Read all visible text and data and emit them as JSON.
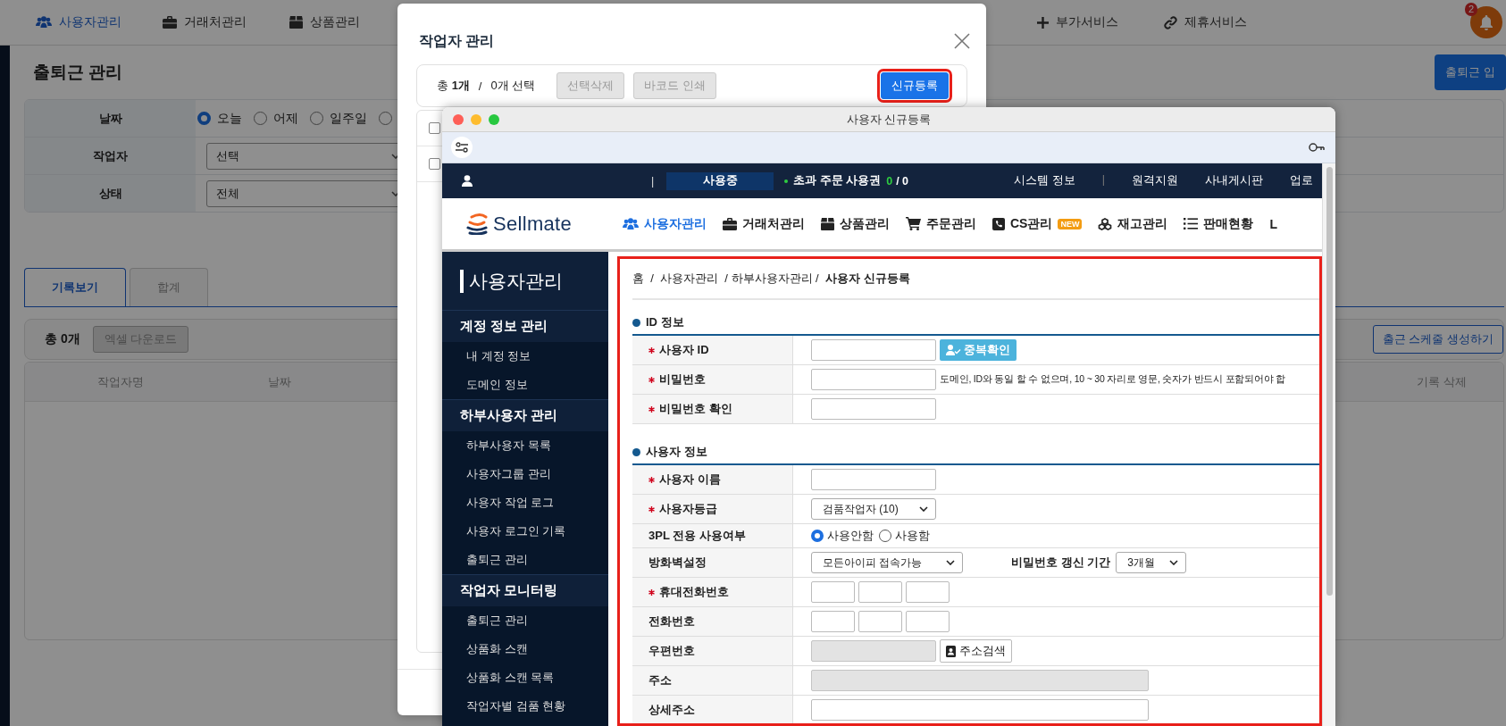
{
  "app_nav": {
    "items": [
      {
        "label": "사용자관리",
        "selected": true
      },
      {
        "label": "거래처관리",
        "selected": false
      },
      {
        "label": "상품관리",
        "selected": false
      }
    ],
    "right_items": [
      {
        "label": "부가서비스"
      },
      {
        "label": "제휴서비스"
      }
    ],
    "notification_badge": "2"
  },
  "page": {
    "title": "출퇴근 관리",
    "top_button": "출퇴근 입",
    "filters": [
      {
        "label": "날짜",
        "kind": "radio",
        "options": [
          {
            "label": "오늘",
            "selected": true
          },
          {
            "label": "어제",
            "selected": false
          },
          {
            "label": "일주일",
            "selected": false
          },
          {
            "selected": false
          }
        ]
      },
      {
        "label": "작업자",
        "kind": "select",
        "value": "선택"
      },
      {
        "label": "상태",
        "kind": "select",
        "value": "전체"
      }
    ],
    "tabs": [
      {
        "label": "기록보기",
        "selected": true
      },
      {
        "label": "합계",
        "selected": false
      }
    ],
    "summary": "총 0개",
    "excel_button": {
      "label": "엑셀 다운로드",
      "disabled": true
    },
    "schedule_button": "출근 스케줄 생성하기",
    "columns": [
      "작업자명",
      "날짜",
      "기록 삭제"
    ]
  },
  "modal": {
    "title": "작업자 관리",
    "summary": "총 **1개**",
    "separator": "/",
    "selection": "0개 선택",
    "buttons": [
      {
        "label": "선택삭제",
        "kind": "plain",
        "disabled": true,
        "highlighted": false
      },
      {
        "label": "바코드 인쇄",
        "kind": "plain",
        "disabled": true,
        "highlighted": false
      },
      {
        "label": "신규등록",
        "kind": "primary",
        "disabled": false,
        "highlighted": true
      }
    ],
    "rows": [
      {
        "checked": false
      },
      {
        "checked": false
      }
    ]
  },
  "signup_window": {
    "title": "사용자 신규등록",
    "topbar": {
      "divider": "|",
      "status": "사용중",
      "quota_label": "초과 주문 사용권",
      "quota_used": "0",
      "quota_total": "/ 0",
      "links": [
        {
          "label": "시스템 정보",
          "divider": "|"
        },
        {
          "label": "원격지원"
        },
        {
          "label": "사내게시판"
        },
        {
          "label": "업로"
        }
      ]
    },
    "logo": "Sellmate",
    "nav": [
      {
        "label": "사용자관리",
        "selected": true
      },
      {
        "label": "거래처관리",
        "selected": false
      },
      {
        "label": "상품관리",
        "selected": false
      },
      {
        "label": "주문관리",
        "selected": false
      },
      {
        "label": "CS관리",
        "selected": false,
        "badge": "NEW"
      },
      {
        "label": "재고관리",
        "selected": false
      },
      {
        "label": "판매현황",
        "selected": false
      },
      {
        "label": "L",
        "selected": false
      }
    ],
    "sidebar": {
      "title": "사용자관리",
      "groups": [
        {
          "label": "계정 정보 관리",
          "items": [
            "내 계정 정보",
            "도메인 정보"
          ]
        },
        {
          "label": "하부사용자 관리",
          "items": [
            "하부사용자 목록",
            "사용자그룹 관리",
            "사용자 작업 로그",
            "사용자 로그인 기록",
            "출퇴근 관리"
          ]
        },
        {
          "label": "작업자 모니터링",
          "items": [
            "출퇴근 관리",
            "상품화 스캔",
            "상품화 스캔 목록",
            "작업자별 검품 현황"
          ]
        }
      ]
    },
    "highlighted": true,
    "breadcrumb": "홈  /  사용자관리  / 하부사용자관리 /  **사용자 신규등록**",
    "sections": [
      {
        "title": "ID 정보",
        "rows": [
          {
            "label": "사용자 ID",
            "required": true,
            "kind": "text_button",
            "button": "중복확인"
          },
          {
            "label": "비밀번호",
            "required": true,
            "kind": "text_hint",
            "hint": "도메인, ID와 동일 할 수 없으며, 10 ~ 30 자리로 영문, 숫자가 반드시 포함되어야 합"
          },
          {
            "label": "비밀번호 확인",
            "required": true,
            "kind": "text"
          }
        ]
      },
      {
        "title": "사용자 정보",
        "rows": [
          {
            "label": "사용자 이름",
            "required": true,
            "kind": "text"
          },
          {
            "label": "사용자등급",
            "required": true,
            "kind": "select",
            "value": "검품작업자 (10)"
          },
          {
            "label": "3PL 전용 사용여부",
            "required": false,
            "kind": "radio",
            "options": [
              {
                "label": "사용안함",
                "selected": true
              },
              {
                "label": "사용함",
                "selected": false
              }
            ]
          },
          {
            "label": "방화벽설정",
            "required": false,
            "kind": "select_pair",
            "value": "모든아이피 접속가능",
            "extra_label": "비밀번호 갱신 기간",
            "extra_value": "3개월"
          },
          {
            "label": "휴대전화번호",
            "required": true,
            "kind": "phone"
          },
          {
            "label": "전화번호",
            "required": false,
            "kind": "phone"
          },
          {
            "label": "우편번호",
            "required": false,
            "kind": "zip",
            "button": "주소검색"
          },
          {
            "label": "주소",
            "required": false,
            "kind": "wide",
            "disabled": true
          },
          {
            "label": "상세주소",
            "required": false,
            "kind": "wide",
            "disabled": false
          }
        ]
      }
    ]
  }
}
